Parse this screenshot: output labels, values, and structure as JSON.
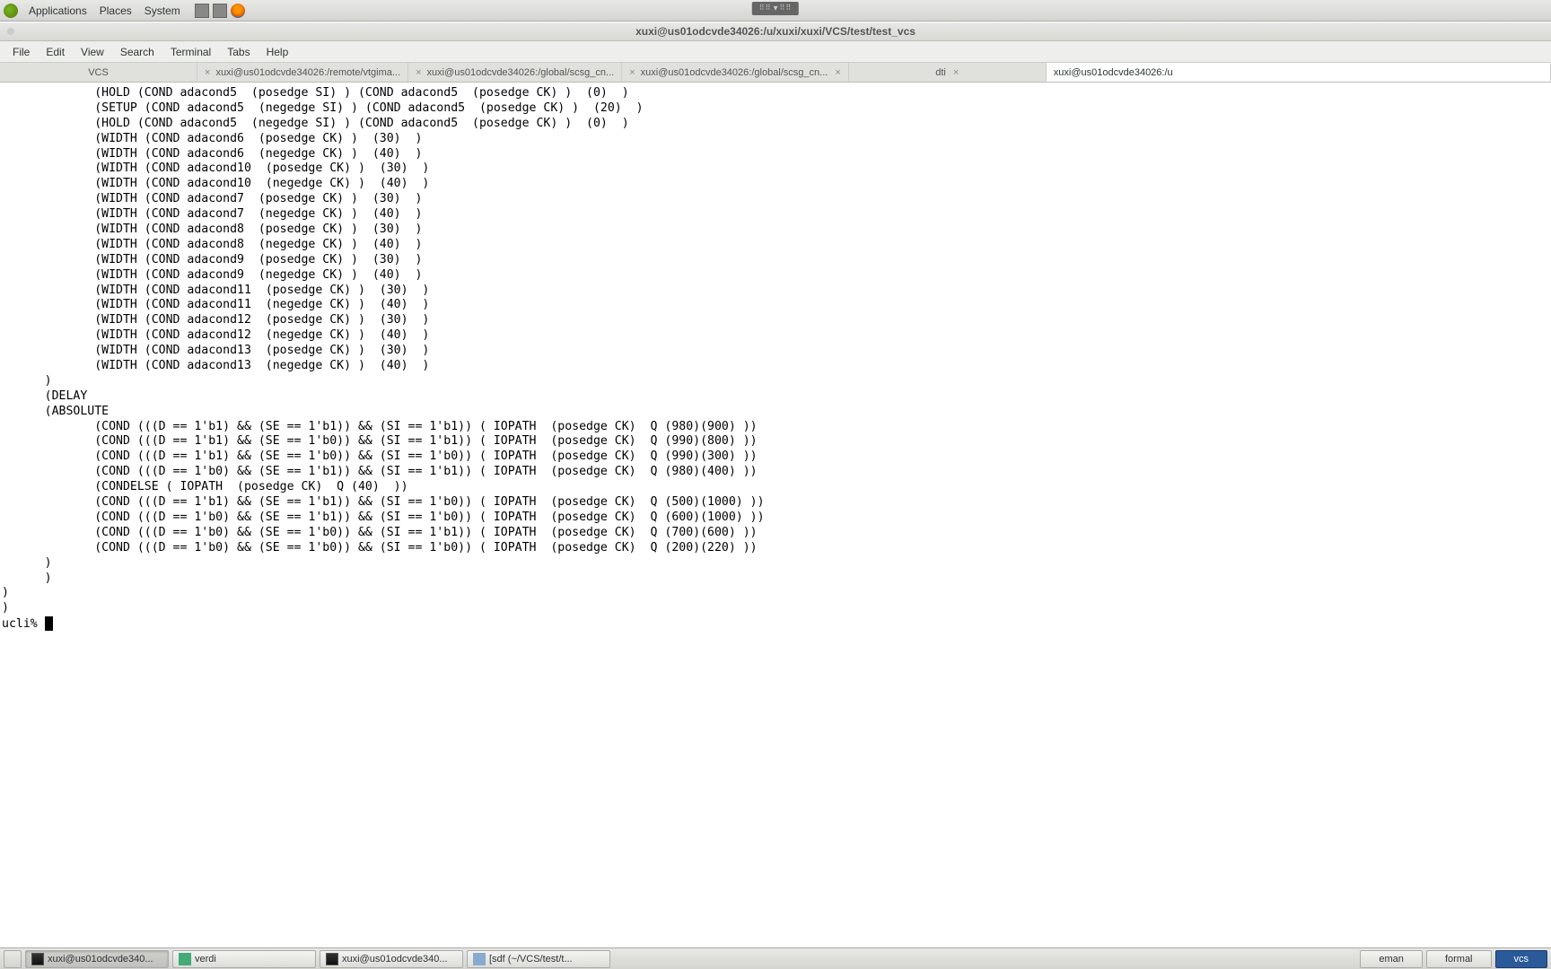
{
  "top_panel": {
    "menus": [
      "Applications",
      "Places",
      "System"
    ]
  },
  "window": {
    "title": "xuxi@us01odcvde34026:/u/xuxi/xuxi/VCS/test/test_vcs"
  },
  "menubar": [
    "File",
    "Edit",
    "View",
    "Search",
    "Terminal",
    "Tabs",
    "Help"
  ],
  "tabs": [
    {
      "label": "VCS",
      "closable": false
    },
    {
      "label": "xuxi@us01odcvde34026:/remote/vtgima...",
      "closable": true
    },
    {
      "label": "xuxi@us01odcvde34026:/global/scsg_cn...",
      "closable": true
    },
    {
      "label": "xuxi@us01odcvde34026:/global/scsg_cn...",
      "closable": true
    },
    {
      "label": "dti",
      "closable": true
    },
    {
      "label": "xuxi@us01odcvde34026:/u",
      "closable": false
    }
  ],
  "terminal_lines": [
    "             (HOLD (COND adacond5  (posedge SI) ) (COND adacond5  (posedge CK) )  (0)  )",
    "             (SETUP (COND adacond5  (negedge SI) ) (COND adacond5  (posedge CK) )  (20)  )",
    "             (HOLD (COND adacond5  (negedge SI) ) (COND adacond5  (posedge CK) )  (0)  )",
    "             (WIDTH (COND adacond6  (posedge CK) )  (30)  )",
    "             (WIDTH (COND adacond6  (negedge CK) )  (40)  )",
    "             (WIDTH (COND adacond10  (posedge CK) )  (30)  )",
    "             (WIDTH (COND adacond10  (negedge CK) )  (40)  )",
    "             (WIDTH (COND adacond7  (posedge CK) )  (30)  )",
    "             (WIDTH (COND adacond7  (negedge CK) )  (40)  )",
    "             (WIDTH (COND adacond8  (posedge CK) )  (30)  )",
    "             (WIDTH (COND adacond8  (negedge CK) )  (40)  )",
    "             (WIDTH (COND adacond9  (posedge CK) )  (30)  )",
    "             (WIDTH (COND adacond9  (negedge CK) )  (40)  )",
    "             (WIDTH (COND adacond11  (posedge CK) )  (30)  )",
    "             (WIDTH (COND adacond11  (negedge CK) )  (40)  )",
    "             (WIDTH (COND adacond12  (posedge CK) )  (30)  )",
    "             (WIDTH (COND adacond12  (negedge CK) )  (40)  )",
    "             (WIDTH (COND adacond13  (posedge CK) )  (30)  )",
    "             (WIDTH (COND adacond13  (negedge CK) )  (40)  )",
    "      )",
    "      (DELAY",
    "      (ABSOLUTE",
    "             (COND (((D == 1'b1) && (SE == 1'b1)) && (SI == 1'b1)) ( IOPATH  (posedge CK)  Q (980)(900) ))",
    "             (COND (((D == 1'b1) && (SE == 1'b0)) && (SI == 1'b1)) ( IOPATH  (posedge CK)  Q (990)(800) ))",
    "             (COND (((D == 1'b1) && (SE == 1'b0)) && (SI == 1'b0)) ( IOPATH  (posedge CK)  Q (990)(300) ))",
    "             (COND (((D == 1'b0) && (SE == 1'b1)) && (SI == 1'b1)) ( IOPATH  (posedge CK)  Q (980)(400) ))",
    "             (CONDELSE ( IOPATH  (posedge CK)  Q (40)  ))",
    "             (COND (((D == 1'b1) && (SE == 1'b1)) && (SI == 1'b0)) ( IOPATH  (posedge CK)  Q (500)(1000) ))",
    "             (COND (((D == 1'b0) && (SE == 1'b1)) && (SI == 1'b0)) ( IOPATH  (posedge CK)  Q (600)(1000) ))",
    "             (COND (((D == 1'b0) && (SE == 1'b0)) && (SI == 1'b1)) ( IOPATH  (posedge CK)  Q (700)(600) ))",
    "             (COND (((D == 1'b0) && (SE == 1'b0)) && (SI == 1'b0)) ( IOPATH  (posedge CK)  Q (200)(220) ))",
    "      )",
    "      )",
    ")",
    ")"
  ],
  "prompt": "ucli% ",
  "taskbar": {
    "left": [
      {
        "label": "xuxi@us01odcvde340...",
        "type": "term",
        "active": true
      },
      {
        "label": "verdi",
        "type": "verdi",
        "active": false
      },
      {
        "label": "xuxi@us01odcvde340...",
        "type": "term",
        "active": false
      },
      {
        "label": "[sdf (~/VCS/test/t...",
        "type": "gedit",
        "active": false
      }
    ],
    "right": [
      {
        "label": "eman",
        "blue": false
      },
      {
        "label": "formal",
        "blue": false
      },
      {
        "label": "vcs",
        "blue": true
      }
    ]
  }
}
